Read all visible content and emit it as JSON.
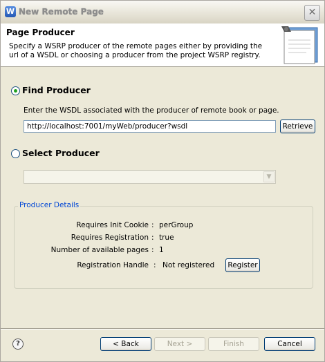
{
  "window": {
    "title": "New Remote Page",
    "app_icon_letter": "W"
  },
  "header": {
    "title": "Page Producer",
    "description": "Specify a WSRP producer of the remote pages either by providing the url of a WSDL or choosing a producer from the project WSRP registry."
  },
  "find_producer": {
    "label": "Find Producer",
    "selected": true,
    "instruction": "Enter the WSDL associated with the producer of remote book or page.",
    "wsdl_value": "http://localhost:7001/myWeb/producer?wsdl",
    "retrieve_label": "Retrieve"
  },
  "select_producer": {
    "label": "Select Producer",
    "selected": false,
    "dropdown_value": ""
  },
  "producer_details": {
    "title": "Producer Details",
    "rows": [
      {
        "label": "Requires Init Cookie",
        "sep": ":",
        "value": "perGroup"
      },
      {
        "label": "Requires Registration",
        "sep": ":",
        "value": "true"
      },
      {
        "label": "Number of available pages",
        "sep": ":",
        "value": "1"
      }
    ],
    "registration_handle": {
      "label": "Registration Handle",
      "sep": ":",
      "value": "Not registered"
    },
    "register_label": "Register"
  },
  "footer": {
    "help_glyph": "?",
    "back_label": "< Back",
    "next_label": "Next >",
    "finish_label": "Finish",
    "cancel_label": "Cancel"
  }
}
